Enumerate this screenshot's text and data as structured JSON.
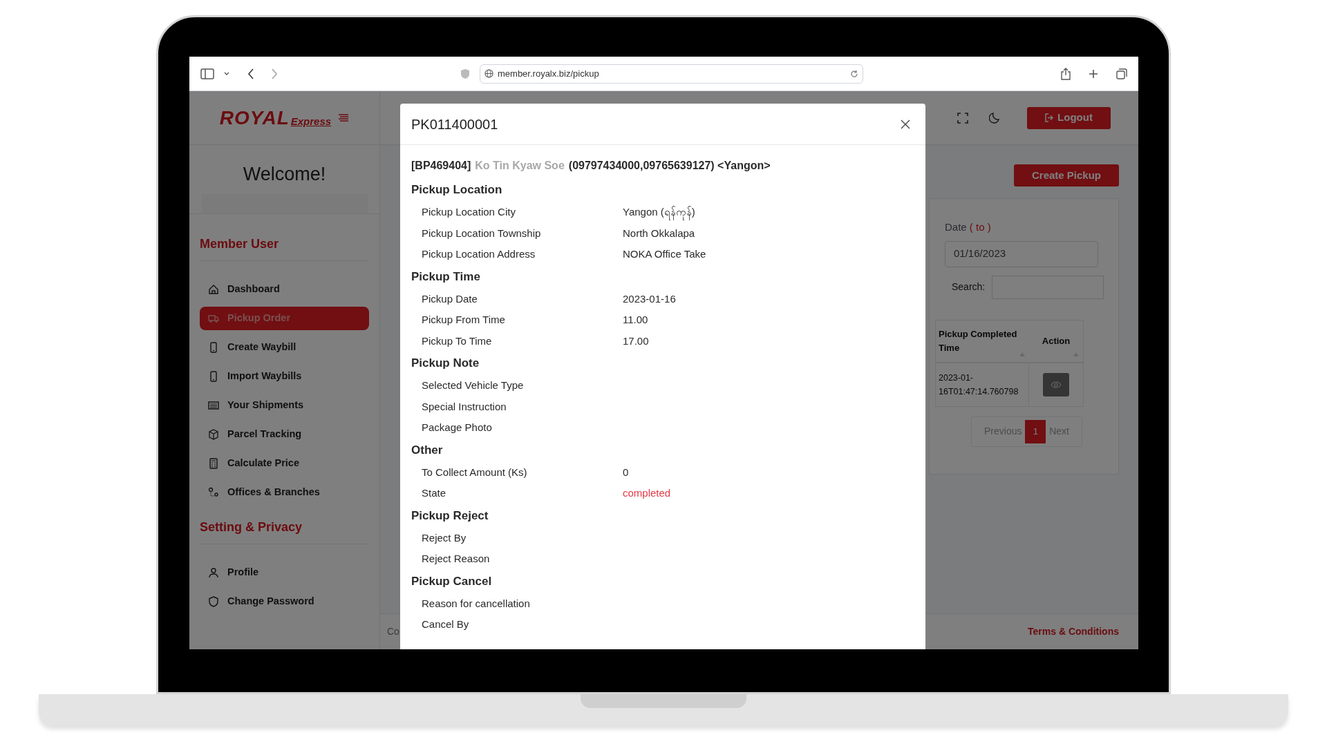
{
  "browser": {
    "url": "member.royalx.biz/pickup"
  },
  "logo": {
    "brand": "ROYAL",
    "sub": "Express"
  },
  "sidebar": {
    "welcome": "Welcome!",
    "sections": [
      {
        "title": "Member User",
        "items": [
          {
            "label": "Dashboard",
            "selected": false
          },
          {
            "label": "Pickup Order",
            "selected": true
          },
          {
            "label": "Create Waybill",
            "selected": false
          },
          {
            "label": "Import Waybills",
            "selected": false
          },
          {
            "label": "Your Shipments",
            "selected": false
          },
          {
            "label": "Parcel Tracking",
            "selected": false
          },
          {
            "label": "Calculate Price",
            "selected": false
          },
          {
            "label": "Offices & Branches",
            "selected": false
          }
        ]
      },
      {
        "title": "Setting & Privacy",
        "items": [
          {
            "label": "Profile",
            "selected": false
          },
          {
            "label": "Change Password",
            "selected": false
          }
        ]
      }
    ]
  },
  "topbar": {
    "logout": "Logout"
  },
  "page": {
    "create_button": "Create Pickup",
    "filter": {
      "date_label": "Date",
      "date_hint": "( to )",
      "date_value": "01/16/2023",
      "search_label": "Search:"
    },
    "table": {
      "columns": [
        "Pickup Completed Time",
        "Action"
      ],
      "rows": [
        {
          "cells": [
            "2023-01-16T01:47:14.760798"
          ]
        }
      ]
    },
    "pagination": {
      "previous": "Previous",
      "pages": [
        {
          "label": "1",
          "selected": true
        }
      ],
      "next": "Next"
    }
  },
  "footer": {
    "left": "Co",
    "right": "Terms & Conditions"
  },
  "modal": {
    "title": "PK011400001",
    "customer": {
      "code": "[BP469404]",
      "name": "Ko Tin Kyaw Soe",
      "contact": "(09797434000,09765639127) <Yangon>"
    },
    "sections": [
      {
        "title": "Pickup Location",
        "rows": [
          {
            "label": "Pickup Location City",
            "value": "Yangon (ရန်ကုန်)",
            "kind": "text"
          },
          {
            "label": "Pickup Location Township",
            "value": "North Okkalapa",
            "kind": "text"
          },
          {
            "label": "Pickup Location Address",
            "value": "NOKA Office Take",
            "kind": "text"
          }
        ]
      },
      {
        "title": "Pickup Time",
        "rows": [
          {
            "label": "Pickup Date",
            "value": "2023-01-16",
            "kind": "text"
          },
          {
            "label": "Pickup From Time",
            "value": "11.00",
            "kind": "text"
          },
          {
            "label": "Pickup To Time",
            "value": "17.00",
            "kind": "text"
          }
        ]
      },
      {
        "title": "Pickup Note",
        "rows": [
          {
            "label": "Selected Vehicle Type"
          },
          {
            "label": "Special Instruction"
          },
          {
            "label": "Package Photo"
          }
        ]
      },
      {
        "title": "Other",
        "rows": [
          {
            "label": "To Collect Amount (Ks)",
            "value": "0",
            "kind": "text"
          },
          {
            "label": "State",
            "value": "completed",
            "kind": "status"
          }
        ]
      },
      {
        "title": "Pickup Reject",
        "rows": [
          {
            "label": "Reject By"
          },
          {
            "label": "Reject Reason"
          }
        ]
      },
      {
        "title": "Pickup Cancel",
        "rows": [
          {
            "label": "Reason for cancellation"
          },
          {
            "label": "Cancel By"
          }
        ]
      }
    ]
  }
}
